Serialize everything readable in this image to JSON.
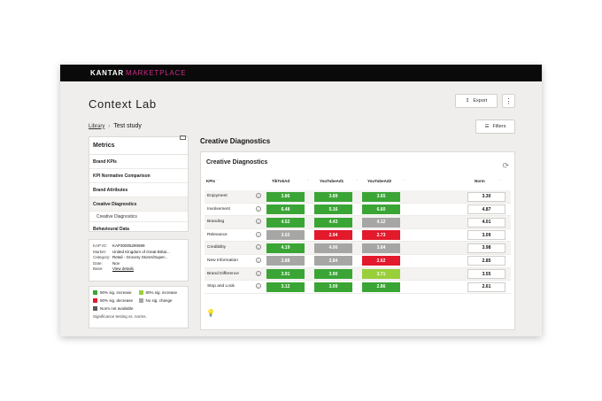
{
  "brand": {
    "part1": "KANTAR",
    "part2": "MARKETPLACE"
  },
  "header": {
    "title": "Context Lab",
    "export_label": "Export",
    "more_label": "⋮"
  },
  "breadcrumb": {
    "library": "Library",
    "separator": "›",
    "current": "Test study"
  },
  "filters_label": "Filters",
  "sidebar": {
    "title": "Metrics",
    "items": [
      {
        "label": "Brand KPIs"
      },
      {
        "label": "KPI Normative Comparison"
      },
      {
        "label": "Brand Attributes"
      },
      {
        "label": "Creative Diagnostics"
      },
      {
        "label": "Creative Diagnostics"
      },
      {
        "label": "Behavioural Data"
      }
    ]
  },
  "info": [
    {
      "key": "KAP ID:",
      "value": "KAP30005290699"
    },
    {
      "key": "Market:",
      "value": "United Kingdom of Great Britai..."
    },
    {
      "key": "Category:",
      "value": "Retail - Grocery Stores/Super..."
    },
    {
      "key": "Date:",
      "value": "Nov"
    },
    {
      "key": "Base:",
      "value": "View details"
    }
  ],
  "legend": {
    "items": [
      {
        "label": "90% sig. increase",
        "color": "#3aa535"
      },
      {
        "label": "80% sig. increase",
        "color": "#99cf3b"
      },
      {
        "label": "90% sig. decrease",
        "color": "#e3192c"
      },
      {
        "label": "No sig. change",
        "color": "#a6a6a4"
      },
      {
        "label": "Norm not available",
        "color": "#5a5a58"
      }
    ],
    "note": "Significance testing vs. norms."
  },
  "section_title": "Creative Diagnostics",
  "panel": {
    "title": "Creative Diagnostics",
    "columns": {
      "kpi": "KPIs",
      "ad1": "TikTokAd",
      "ad2": "YouTubeAd1",
      "ad3": "YouTubeAd2",
      "norm": "Norm"
    },
    "rows": [
      {
        "kpi": "Enjoyment",
        "v1": "3.86",
        "c1": "#3aa535",
        "v2": "3.89",
        "c2": "#3aa535",
        "v3": "3.65",
        "c3": "#3aa535",
        "norm": "3.30"
      },
      {
        "kpi": "Involvement",
        "v1": "6.48",
        "c1": "#3aa535",
        "v2": "5.16",
        "c2": "#3aa535",
        "v3": "6.60",
        "c3": "#3aa535",
        "norm": "4.87"
      },
      {
        "kpi": "Branding",
        "v1": "4.52",
        "c1": "#3aa535",
        "v2": "4.43",
        "c2": "#3aa535",
        "v3": "4.12",
        "c3": "#a6a6a4",
        "norm": "4.01"
      },
      {
        "kpi": "Relevance",
        "v1": "3.02",
        "c1": "#a6a6a4",
        "v2": "2.94",
        "c2": "#e3192c",
        "v3": "2.73",
        "c3": "#e3192c",
        "norm": "3.09"
      },
      {
        "kpi": "Credibility",
        "v1": "4.19",
        "c1": "#3aa535",
        "v2": "4.06",
        "c2": "#a6a6a4",
        "v3": "3.84",
        "c3": "#a6a6a4",
        "norm": "3.98"
      },
      {
        "kpi": "New Information",
        "v1": "2.88",
        "c1": "#a6a6a4",
        "v2": "2.84",
        "c2": "#a6a6a4",
        "v3": "2.62",
        "c3": "#e3192c",
        "norm": "2.85"
      },
      {
        "kpi": "Brand Difference",
        "v1": "3.91",
        "c1": "#3aa535",
        "v2": "3.90",
        "c2": "#3aa535",
        "v3": "3.71",
        "c3": "#99cf3b",
        "norm": "3.55"
      },
      {
        "kpi": "Stop and Look",
        "v1": "3.12",
        "c1": "#3aa535",
        "v2": "3.09",
        "c2": "#3aa535",
        "v3": "2.86",
        "c3": "#3aa535",
        "norm": "2.61"
      }
    ]
  }
}
